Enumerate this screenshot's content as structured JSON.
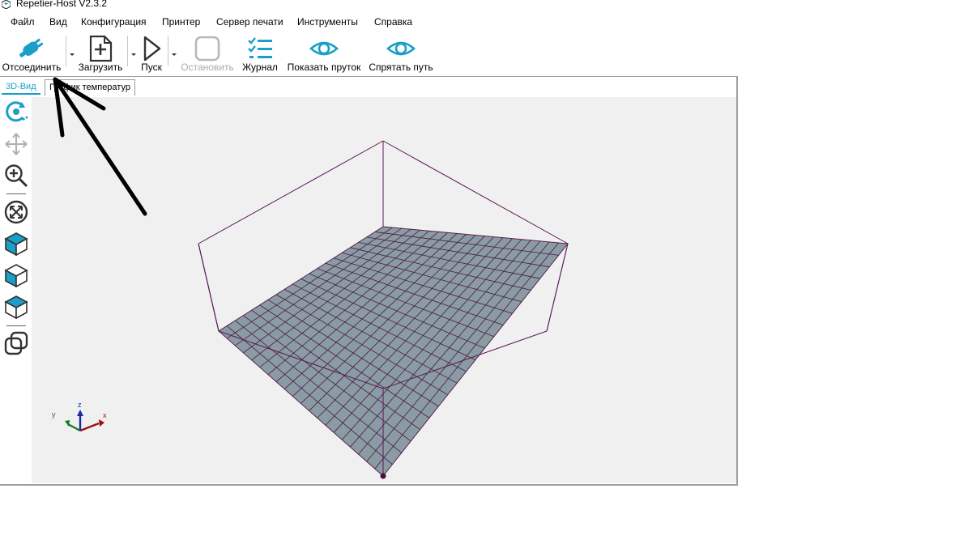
{
  "window": {
    "title": "Repetier-Host V2.3.2"
  },
  "menu": {
    "items": [
      "Файл",
      "Вид",
      "Конфигурация",
      "Принтер",
      "Сервер печати",
      "Инструменты",
      "Справка"
    ]
  },
  "toolbar": {
    "disconnect_label": "Отсоединить",
    "load_label": "Загрузить",
    "start_label": "Пуск",
    "stop_label": "Остановить",
    "log_label": "Журнал",
    "show_filament_label": "Показать пруток",
    "hide_path_label": "Спрятать путь"
  },
  "tabs": {
    "view3d": "3D-Вид",
    "temperature": "График температур"
  },
  "icons": {
    "disconnect": "plug-icon",
    "load": "add-file-icon",
    "start": "play-icon",
    "stop": "stop-icon",
    "log": "checklist-icon",
    "show_filament": "eye-icon",
    "hide_path": "eye-icon",
    "rotate": "rotate-icon",
    "move": "move-icon",
    "zoom": "zoom-icon",
    "fit": "fit-icon",
    "iso": "cube-icon",
    "front": "cube-front-icon",
    "top": "cube-top-icon",
    "parallel": "parallel-view-icon"
  },
  "colors": {
    "accent": "#1aa0c8",
    "bed": "#8a9ba3",
    "grid": "#5a2050",
    "frame": "#5a1a5a",
    "viewport_bg": "#f0f0f0"
  }
}
